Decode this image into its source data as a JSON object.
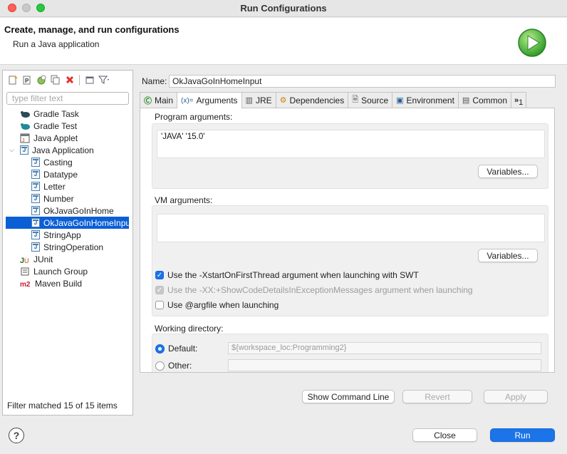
{
  "window": {
    "title": "Run Configurations"
  },
  "header": {
    "title": "Create, manage, and run configurations",
    "subtitle": "Run a Java application"
  },
  "left": {
    "filter_placeholder": "type filter text",
    "items": [
      {
        "label": "Gradle Task",
        "icon": "gradle-task-icon"
      },
      {
        "label": "Gradle Test",
        "icon": "gradle-test-icon"
      },
      {
        "label": "Java Applet",
        "icon": "java-applet-icon"
      },
      {
        "label": "Java Application",
        "icon": "java-app-icon"
      },
      {
        "label": "Casting"
      },
      {
        "label": "Datatype"
      },
      {
        "label": "Letter"
      },
      {
        "label": "Number"
      },
      {
        "label": "OkJavaGoInHome"
      },
      {
        "label": "OkJavaGoInHomeInput"
      },
      {
        "label": "StringApp"
      },
      {
        "label": "StringOperation"
      },
      {
        "label": "JUnit",
        "icon": "junit-icon"
      },
      {
        "label": "Launch Group",
        "icon": "launch-group-icon"
      },
      {
        "label": "Maven Build",
        "icon": "maven-icon"
      }
    ],
    "status": "Filter matched 15 of 15 items"
  },
  "name": {
    "label": "Name:",
    "value": "OkJavaGoInHomeInput"
  },
  "tabs": [
    {
      "label": "Main",
      "icon": "C"
    },
    {
      "label": "Arguments",
      "icon": "(x)="
    },
    {
      "label": "JRE",
      "icon": "▥"
    },
    {
      "label": "Dependencies",
      "icon": "⚙"
    },
    {
      "label": "Source",
      "icon": "🗎"
    },
    {
      "label": "Environment",
      "icon": "▣"
    },
    {
      "label": "Common",
      "icon": "▤"
    },
    {
      "label": "1",
      "icon": "»"
    }
  ],
  "args": {
    "program_label": "Program arguments:",
    "program_value": "'JAVA' '15.0'",
    "variables_label": "Variables...",
    "vm_label": "VM arguments:",
    "vm_value": "",
    "vm_variables_label": "Variables...",
    "chk1": "Use the -XstartOnFirstThread argument when launching with SWT",
    "chk2": "Use the -XX:+ShowCodeDetailsInExceptionMessages argument when launching",
    "chk3": "Use @argfile when launching",
    "wd_label": "Working directory:",
    "default_label": "Default:",
    "default_value": "${workspace_loc:Programming2}",
    "other_label": "Other:",
    "other_value": ""
  },
  "buttons": {
    "show_cmd": "Show Command Line",
    "revert": "Revert",
    "apply": "Apply",
    "close": "Close",
    "run": "Run"
  },
  "help": "?"
}
